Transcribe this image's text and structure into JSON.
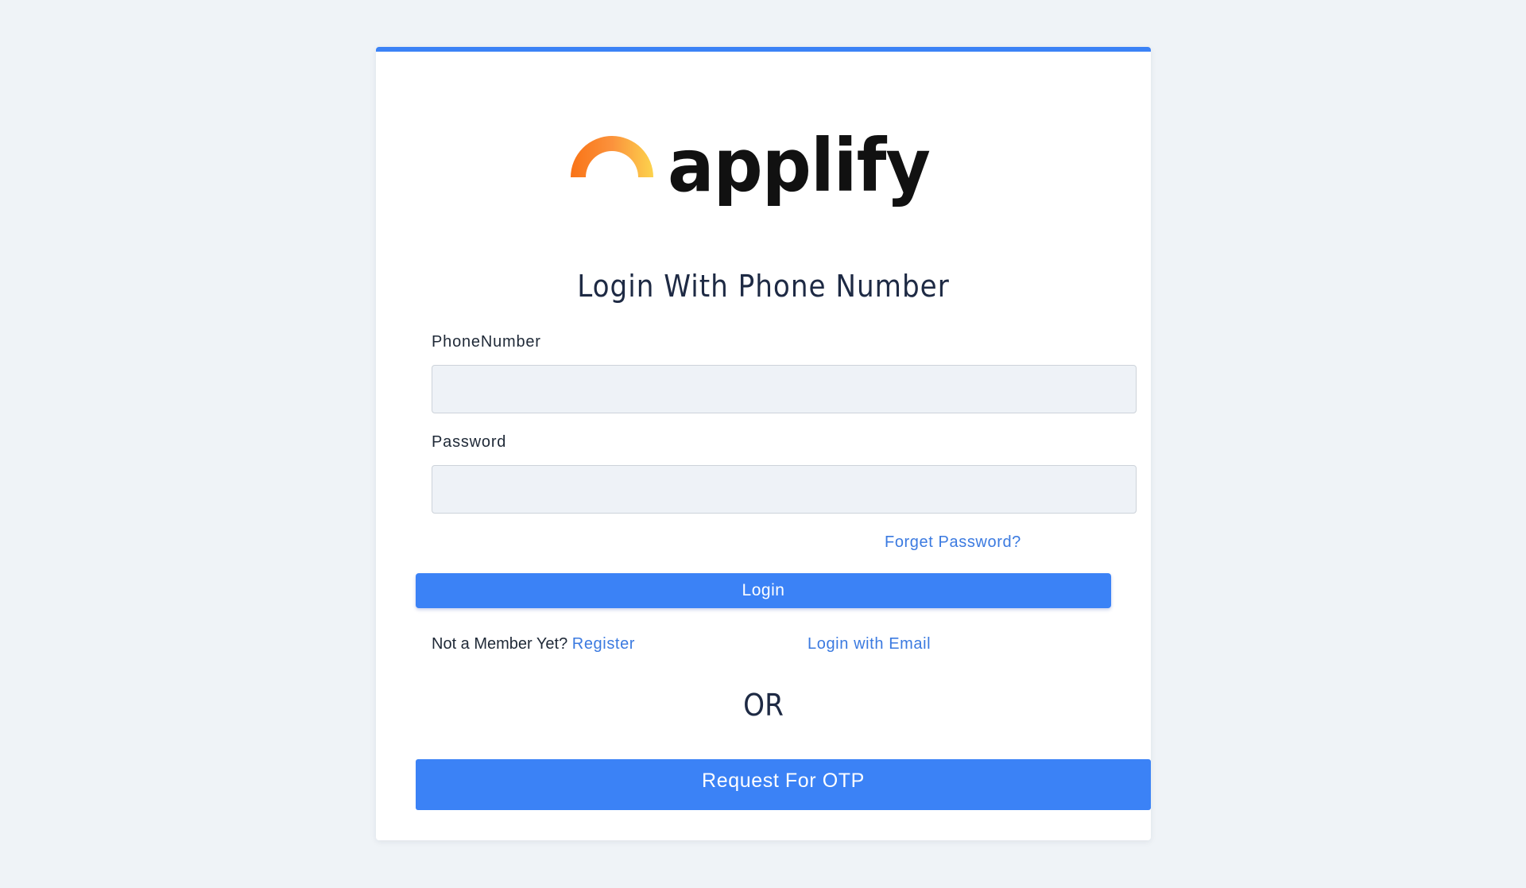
{
  "brand": {
    "name": "applify",
    "arc_color_start": "#f97316",
    "arc_color_end": "#fcd34d",
    "text_color": "#111111"
  },
  "login": {
    "title": "Login With Phone Number",
    "phone_label": "PhoneNumber",
    "phone_value": "",
    "password_label": "Password",
    "password_value": "",
    "forgot_link": "Forget Password?",
    "login_button": "Login",
    "not_member_text": "Not a Member Yet?",
    "register_link": "Register",
    "email_link": "Login with Email",
    "or_text": "OR",
    "otp_button": "Request For OTP"
  },
  "colors": {
    "accent": "#3b82f6",
    "link": "#3b7ae0",
    "background": "#eff3f7"
  }
}
